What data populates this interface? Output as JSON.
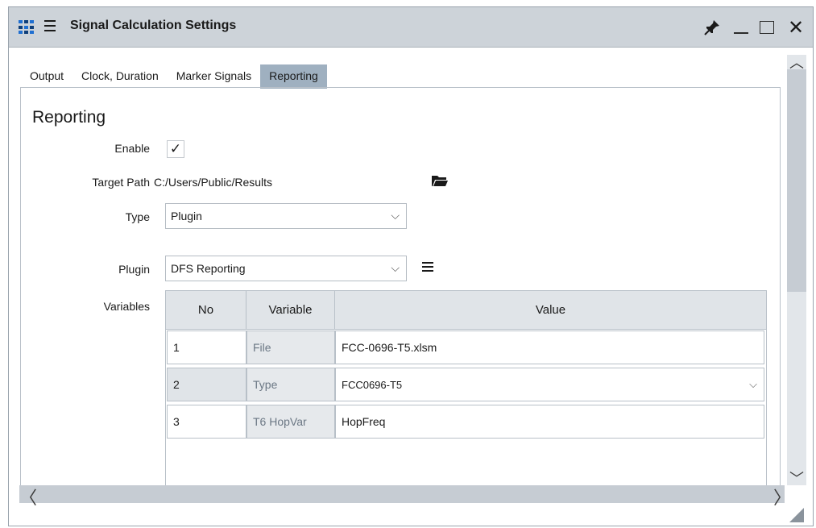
{
  "window": {
    "title": "Signal Calculation Settings"
  },
  "tabs": [
    {
      "label": "Output"
    },
    {
      "label": "Clock, Duration"
    },
    {
      "label": "Marker Signals"
    },
    {
      "label": "Reporting",
      "active": true
    }
  ],
  "reporting": {
    "section_title": "Reporting",
    "enable_label": "Enable",
    "enable_checked": true,
    "enable_check_glyph": "✓",
    "target_path_label": "Target Path",
    "target_path_value": "C:/Users/Public/Results",
    "type_label": "Type",
    "type_value": "Plugin",
    "plugin_label": "Plugin",
    "plugin_value": "DFS Reporting",
    "variables_label": "Variables"
  },
  "variables_table": {
    "columns": [
      "No",
      "Variable",
      "Value"
    ],
    "rows": [
      {
        "no": "1",
        "variable": "File",
        "value": "FCC-0696-T5.xlsm"
      },
      {
        "no": "2",
        "variable": "Type",
        "value": "FCC0696-T5"
      },
      {
        "no": "3",
        "variable": "T6 HopVar",
        "value": "HopFreq"
      }
    ]
  },
  "icons": {
    "app": "app-grid-icon",
    "menu": "hamburger-icon",
    "pin": "pin-icon",
    "minimize": "minimize-icon",
    "maximize": "maximize-icon",
    "close": "close-icon",
    "folder": "folder-icon",
    "plugin_menu": "list-menu-icon",
    "close_glyph": "✕",
    "chevron_glyph": "⌵",
    "scroll_up_glyph": "︿",
    "scroll_down_glyph": "﹀",
    "scroll_left_glyph": "〈",
    "scroll_right_glyph": "〉"
  },
  "colors": {
    "titlebar": "#cdd3d9",
    "active_tab": "#9fb0c0",
    "accent": "#1f6fd1",
    "table_header": "#e0e4e8"
  }
}
